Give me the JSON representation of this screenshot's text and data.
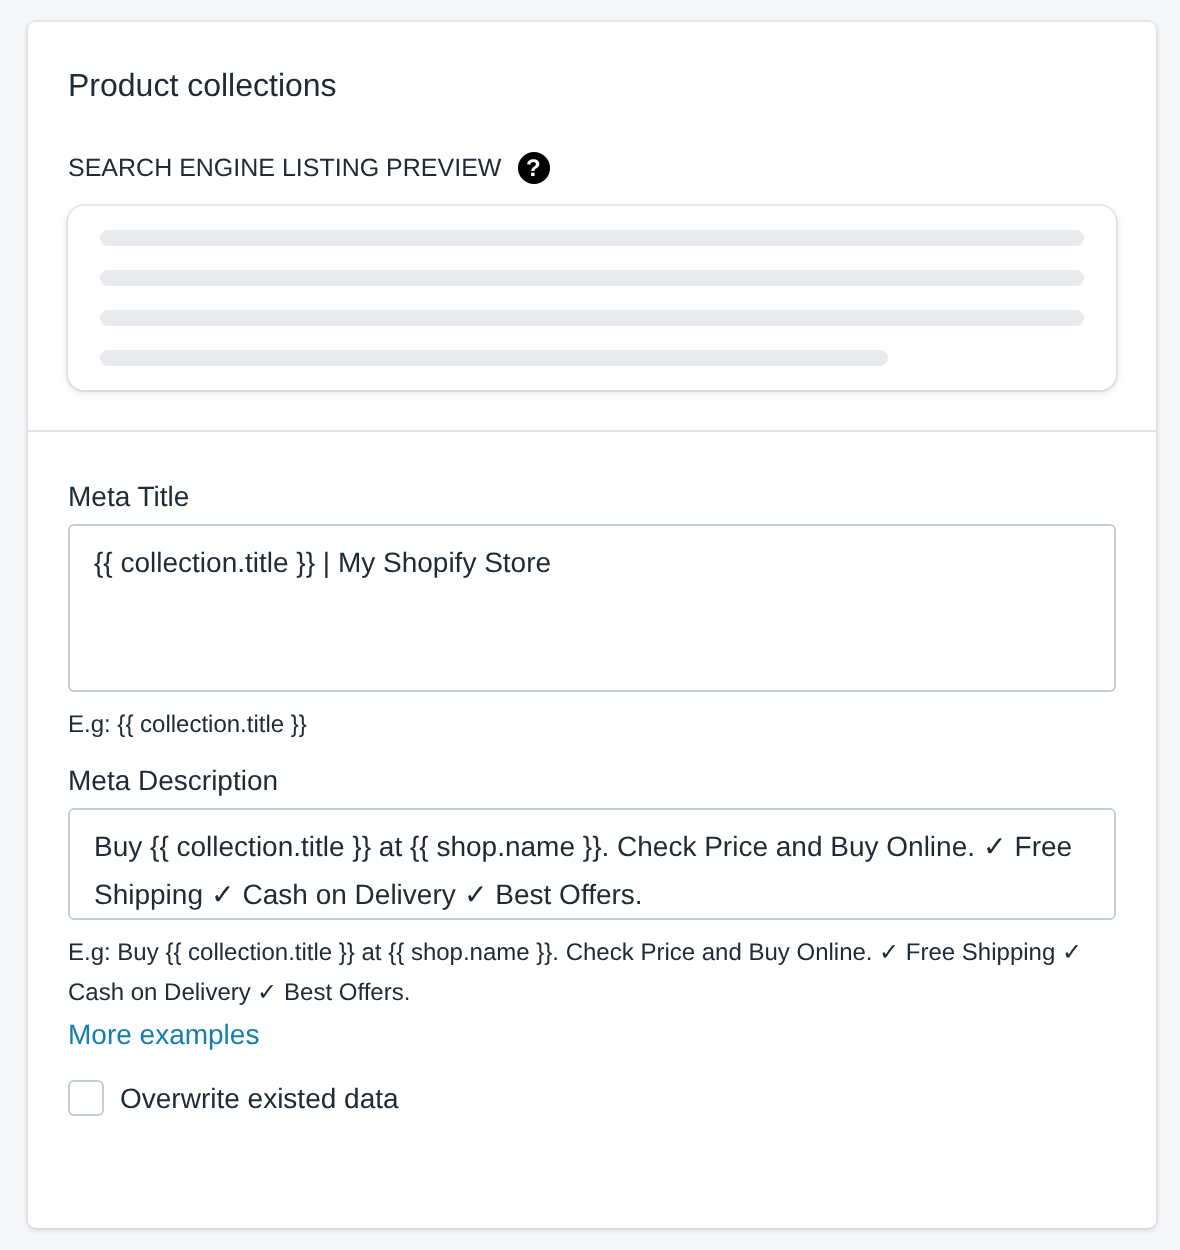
{
  "card": {
    "title": "Product collections"
  },
  "preview": {
    "heading": "SEARCH ENGINE LISTING PREVIEW",
    "help_icon": "?"
  },
  "fields": [
    {
      "label": "Meta Title",
      "value": "{{ collection.title }} | My Shopify Store",
      "hint": "E.g: {{ collection.title }}"
    },
    {
      "label": "Meta Description",
      "value": "Buy {{ collection.title }} at {{ shop.name }}. Check Price and Buy Online. ✓ Free Shipping ✓ Cash on Delivery ✓ Best Offers.",
      "hint": "E.g: Buy {{ collection.title }} at {{ shop.name }}. Check Price and Buy Online. ✓ Free Shipping ✓ Cash on Delivery ✓ Best Offers."
    }
  ],
  "more_link": "More examples",
  "overwrite": {
    "label": "Overwrite existed data",
    "checked": false
  }
}
